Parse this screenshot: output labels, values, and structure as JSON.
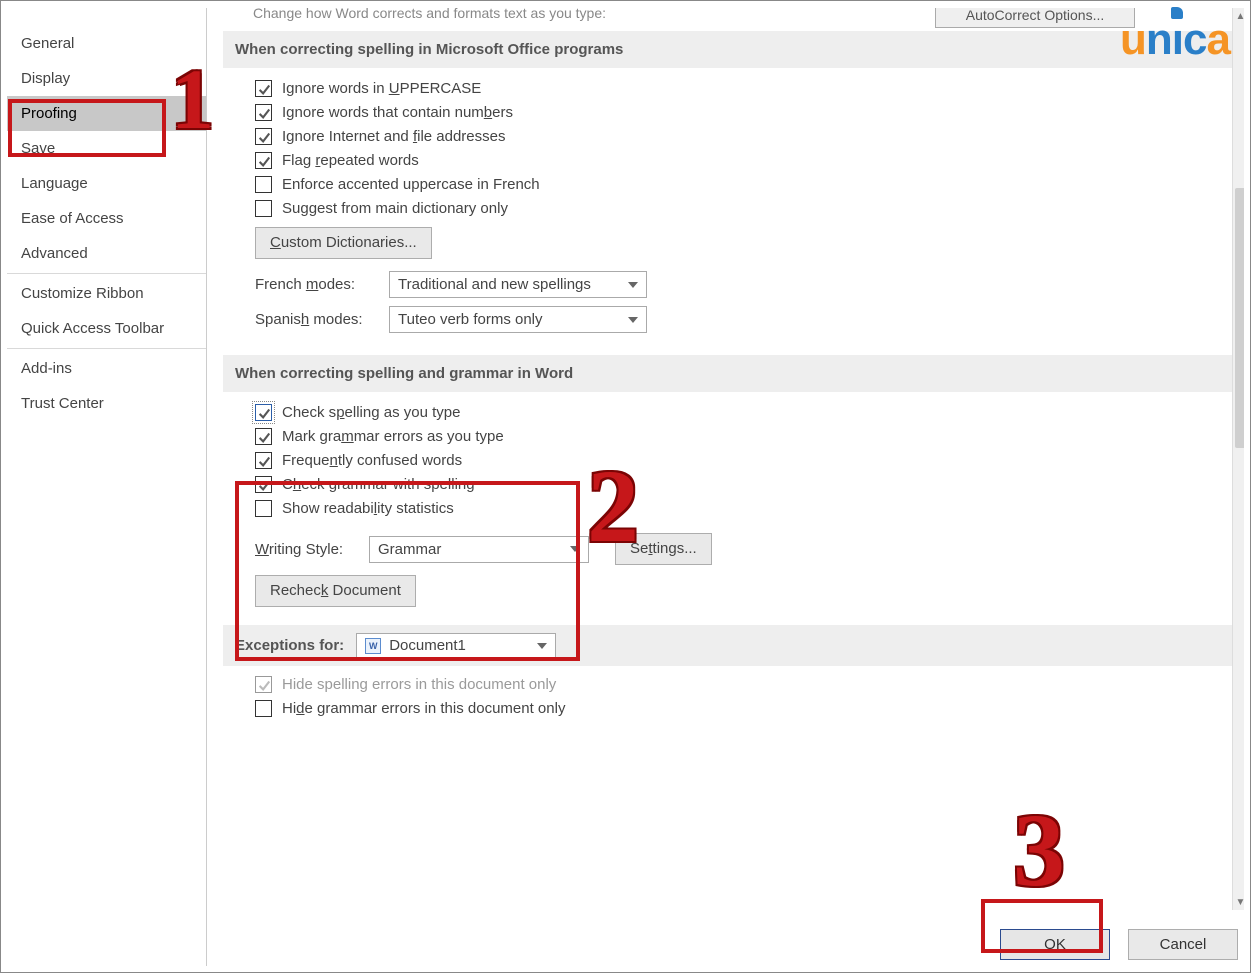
{
  "logo_letters": {
    "u": "u",
    "n": "n",
    "i": "ı",
    "c": "c",
    "a": "a"
  },
  "sidebar": {
    "items": [
      {
        "label": "General"
      },
      {
        "label": "Display"
      },
      {
        "label": "Proofing"
      },
      {
        "label": "Save"
      },
      {
        "label": "Language"
      },
      {
        "label": "Ease of Access"
      },
      {
        "label": "Advanced"
      },
      {
        "label": "Customize Ribbon"
      },
      {
        "label": "Quick Access Toolbar"
      },
      {
        "label": "Add-ins"
      },
      {
        "label": "Trust Center"
      }
    ]
  },
  "top_truncated": "Change how Word corrects and formats text as you type:",
  "autocorrect_btn": "AutoCorrect Options...",
  "section1": {
    "header": "When correcting spelling in Microsoft Office programs",
    "c1": "Ignore words in UPPERCASE",
    "c2": "Ignore words that contain numbers",
    "c3": "Ignore Internet and file addresses",
    "c4": "Flag repeated words",
    "c5": "Enforce accented uppercase in French",
    "c6": "Suggest from main dictionary only",
    "custom_dict_btn": "Custom Dictionaries...",
    "french_label": "French modes:",
    "french_value": "Traditional and new spellings",
    "spanish_label": "Spanish modes:",
    "spanish_value": "Tuteo verb forms only"
  },
  "section2": {
    "header": "When correcting spelling and grammar in Word",
    "c1": "Check spelling as you type",
    "c2": "Mark grammar errors as you type",
    "c3": "Frequently confused words",
    "c4": "Check grammar with spelling",
    "c5": "Show readability statistics",
    "ws_label": "Writing Style:",
    "ws_value": "Grammar",
    "settings_btn": "Settings...",
    "recheck_btn": "Recheck Document"
  },
  "exceptions": {
    "label": "Exceptions for:",
    "doc": "Document1",
    "c1": "Hide spelling errors in this document only",
    "c2": "Hide grammar errors in this document only"
  },
  "footer": {
    "ok": "OK",
    "cancel": "Cancel"
  },
  "annotations": {
    "n1": "1",
    "n2": "2",
    "n3": "3"
  }
}
